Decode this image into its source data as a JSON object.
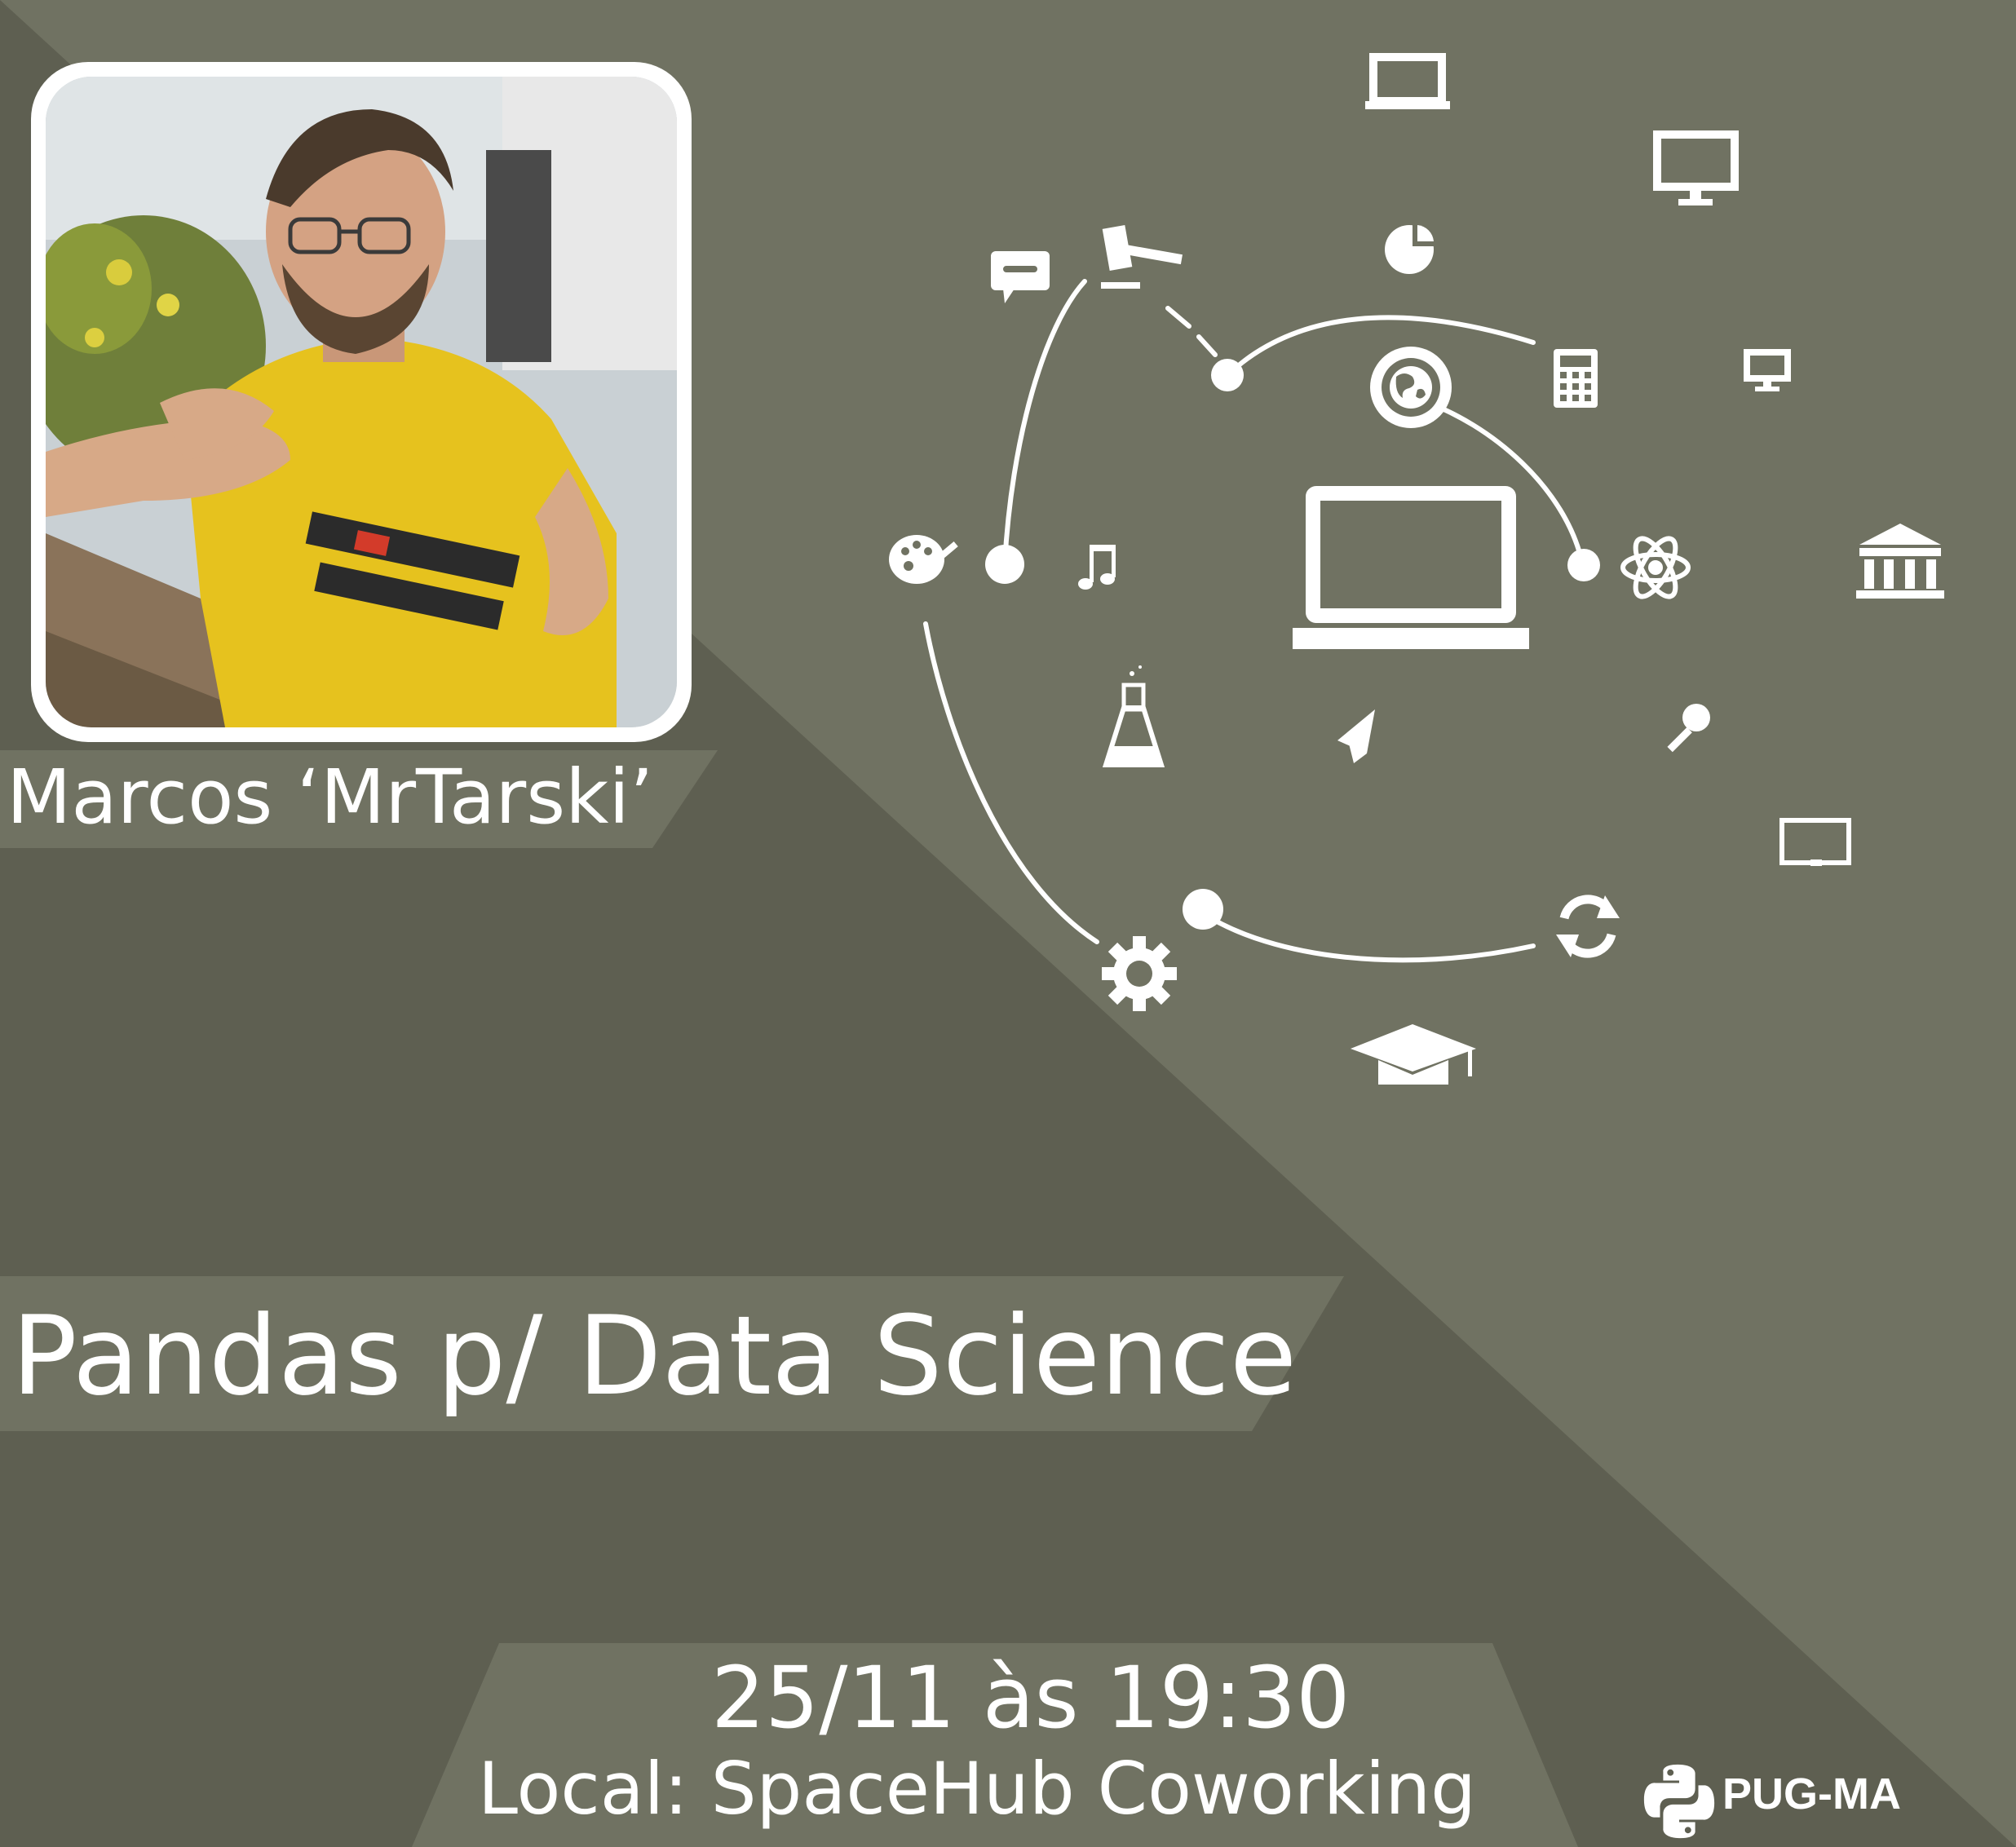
{
  "speaker": {
    "name": "Marcos ‘MrTarski’",
    "photo_alt": "speaker-photo"
  },
  "talk": {
    "title": "Pandas p/ Data Science"
  },
  "event": {
    "datetime": "25/11 às 19:30",
    "location": "Local:  SpaceHub Coworking"
  },
  "brand": {
    "name": "PUG-MA"
  },
  "colors": {
    "dark_bg": "#5e5f51",
    "light_bg": "#707262",
    "banner_bg": "#707262",
    "text": "#ffffff",
    "photo_shirt": "#e6c21e"
  },
  "icons": [
    "laptop-icon",
    "monitor-icon",
    "pie-chart-icon",
    "chat-bubble-icon",
    "gavel-icon",
    "calculator-icon",
    "small-monitor-icon",
    "globe-icon",
    "palette-icon",
    "music-note-icon",
    "central-laptop-icon",
    "atom-icon",
    "bank-icon",
    "flask-icon",
    "paper-plane-icon",
    "magnifier-icon",
    "book-icon",
    "refresh-icon",
    "gear-icon",
    "graduation-cap-icon"
  ]
}
